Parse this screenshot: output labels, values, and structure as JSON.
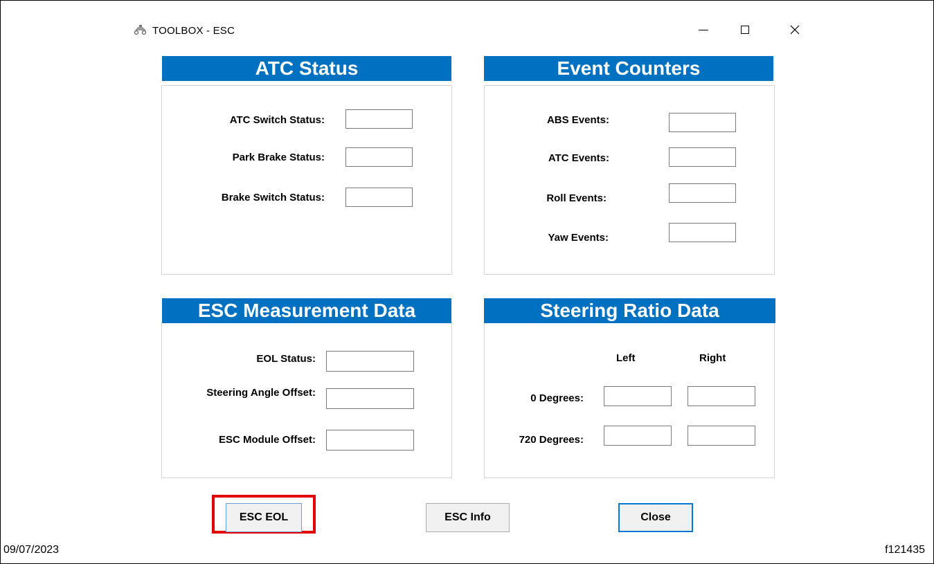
{
  "window": {
    "title": "TOOLBOX - ESC",
    "icon": "toolbox-icon"
  },
  "atc_status": {
    "heading": "ATC Status",
    "rows": [
      {
        "label": "ATC Switch Status:",
        "value": ""
      },
      {
        "label": "Park Brake Status:",
        "value": ""
      },
      {
        "label": "Brake Switch Status:",
        "value": ""
      }
    ]
  },
  "event_counters": {
    "heading": "Event Counters",
    "rows": [
      {
        "label": "ABS Events:",
        "value": ""
      },
      {
        "label": "ATC Events:",
        "value": ""
      },
      {
        "label": "Roll Events:",
        "value": ""
      },
      {
        "label": "Yaw Events:",
        "value": ""
      }
    ]
  },
  "esc_measurement": {
    "heading": "ESC Measurement Data",
    "rows": [
      {
        "label": "EOL Status:",
        "value": ""
      },
      {
        "label": "Steering Angle Offset:",
        "value": ""
      },
      {
        "label": "ESC Module Offset:",
        "value": ""
      }
    ]
  },
  "steering_ratio": {
    "heading": "Steering Ratio Data",
    "columns": [
      "Left",
      "Right"
    ],
    "rows": [
      {
        "label": "0 Degrees:",
        "left": "",
        "right": ""
      },
      {
        "label": "720 Degrees:",
        "left": "",
        "right": ""
      }
    ]
  },
  "buttons": {
    "esc_eol": "ESC EOL",
    "esc_info": "ESC Info",
    "close": "Close"
  },
  "footer": {
    "date": "09/07/2023",
    "figure_id": "f121435"
  },
  "colors": {
    "header_blue": "#0070c0",
    "highlight_red": "#e30000",
    "close_border": "#0078d7"
  }
}
